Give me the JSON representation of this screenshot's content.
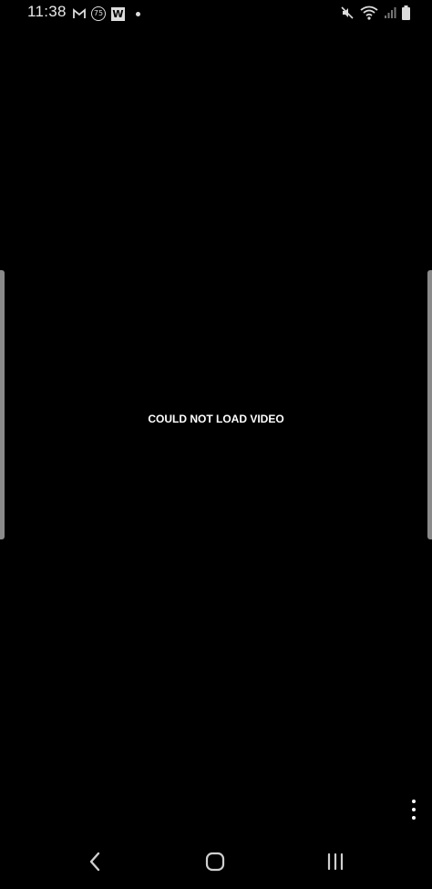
{
  "status_bar": {
    "time": "11:38",
    "notification_badge_number": "75",
    "notification_badge_letter": "W",
    "icons": [
      "gmail-icon",
      "badge-75-icon",
      "w-app-icon",
      "notification-dot-icon",
      "mute-icon",
      "wifi-icon",
      "signal-icon",
      "battery-icon"
    ]
  },
  "player": {
    "message": "COULD NOT LOAD VIDEO"
  },
  "nav_bar": {
    "buttons": [
      "back-icon",
      "home-icon",
      "recents-icon"
    ]
  },
  "colors": {
    "background": "#000000",
    "text": "#ffffff",
    "edge_handle": "#8a8a8a"
  }
}
